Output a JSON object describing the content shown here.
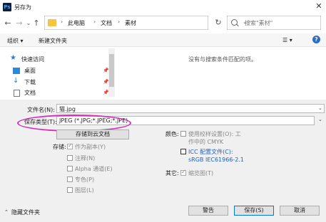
{
  "window": {
    "title": "另存为",
    "close": "✕"
  },
  "nav": {
    "back": "←",
    "forward": "→",
    "dropdown": "⌄",
    "up": "↑",
    "refresh": "↻"
  },
  "address": {
    "crumbs": [
      "此电脑",
      "文档",
      "素材"
    ],
    "separator": "›",
    "dropdown": "⌄"
  },
  "search": {
    "placeholder": "搜索\"素材\""
  },
  "toolbar": {
    "organize": "组织 ▾",
    "new_folder": "新建文件夹",
    "view": "☰ ▾",
    "help": "?"
  },
  "sidebar": {
    "items": [
      {
        "label": "快速访问",
        "icon": "star-icon",
        "color": "#2a7bd6",
        "pinned": false
      },
      {
        "label": "桌面",
        "icon": "desktop-icon",
        "color": "#2a8ad8",
        "pinned": true
      },
      {
        "label": "下载",
        "icon": "download-icon",
        "color": "#2a7bd6",
        "pinned": true
      },
      {
        "label": "文档",
        "icon": "document-icon",
        "color": "#6b7b8c",
        "pinned": true
      }
    ],
    "pin_glyph": "📌"
  },
  "main": {
    "empty_message": "没有与搜索条件匹配的项。"
  },
  "filename": {
    "label": "文件名(N):",
    "value": "猫.jpg"
  },
  "filetype": {
    "label": "保存类型(T):",
    "value": "JPEG (*.JPG;*.JPEG;*.JPE)"
  },
  "save_cloud_button": "存储到云文档",
  "options": {
    "save_label": "存储:",
    "as_copy": "作为副本(Y)",
    "notes": "注释(N)",
    "alpha": "Alpha 通道(E)",
    "spot": "专色(P)",
    "layers": "图层(L)"
  },
  "color": {
    "label": "颜色:",
    "proof_line1": "使用校样设置(O): 工",
    "proof_line2": "作中的 CMYK",
    "icc_line1": "ICC 配置文件(C):",
    "icc_line2": "sRGB IEC61966-2.1"
  },
  "other": {
    "label": "其它:",
    "thumbnail": "缩览图(T)"
  },
  "footer": {
    "hide_folders": "隐藏文件夹",
    "warning_button": "警告",
    "save_button": "保存(S)",
    "cancel_button": "取消"
  },
  "colors": {
    "accent": "#0078d7",
    "highlight_oval": "#d32fb8",
    "link_blue": "#1a62c4"
  }
}
